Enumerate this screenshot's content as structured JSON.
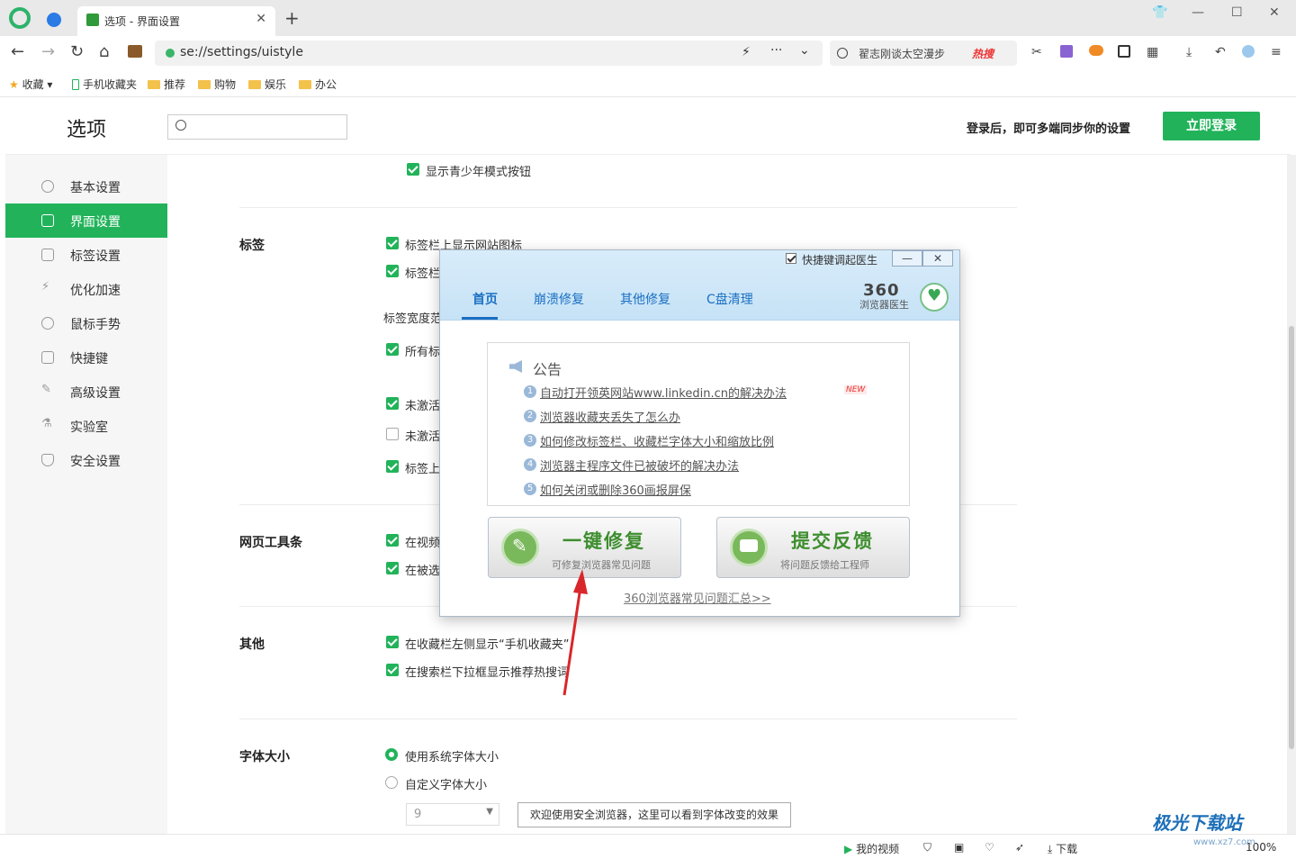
{
  "browser": {
    "tab_title": "选项 - 界面设置",
    "address": "se://settings/uistyle",
    "search_query": "翟志刚谈太空漫步",
    "search_hot": "热搜",
    "bookmarks": [
      "收藏",
      "手机收藏夹",
      "推荐",
      "购物",
      "娱乐",
      "办公"
    ]
  },
  "page": {
    "title": "选项",
    "login_hint": "登录后，即可多端同步你的设置",
    "login_button": "立即登录"
  },
  "sidebar": {
    "items": [
      {
        "label": "基本设置",
        "icon": "gear-icon"
      },
      {
        "label": "界面设置",
        "icon": "window-icon"
      },
      {
        "label": "标签设置",
        "icon": "tab-icon"
      },
      {
        "label": "优化加速",
        "icon": "lightning-icon"
      },
      {
        "label": "鼠标手势",
        "icon": "mouse-icon"
      },
      {
        "label": "快捷键",
        "icon": "keyboard-icon"
      },
      {
        "label": "高级设置",
        "icon": "wrench-icon"
      },
      {
        "label": "实验室",
        "icon": "flask-icon"
      },
      {
        "label": "安全设置",
        "icon": "shield-icon"
      }
    ]
  },
  "content": {
    "teen_mode": "显示青少年模式按钮",
    "tabs_section": "标签",
    "tabs_opt1": "标签栏上显示网站图标",
    "tabs_opt2": "标签栏",
    "tab_width": "标签宽度范",
    "tabs_opt3": "所有标",
    "tabs_opt4": "未激活",
    "tabs_opt5": "未激活",
    "tabs_opt6": "标签上",
    "toolbar_section": "网页工具条",
    "toolbar_opt1": "在视频",
    "toolbar_opt2": "在被选",
    "other_section": "其他",
    "other_opt1": "在收藏栏左侧显示“手机收藏夹”",
    "other_opt2": "在搜索栏下拉框显示推荐热搜词",
    "font_section": "字体大小",
    "font_opt1": "使用系统字体大小",
    "font_opt2": "自定义字体大小",
    "font_size_value": "9",
    "font_preview": "欢迎使用安全浏览器，这里可以看到字体改变的效果"
  },
  "statusbar": {
    "my_video": "我的视频",
    "download": "下载",
    "zoom": "100%"
  },
  "doctor": {
    "hotkey_label": "快捷键调起医生",
    "minimize": "—",
    "close": "✕",
    "tabs": [
      "首页",
      "崩溃修复",
      "其他修复",
      "C盘清理"
    ],
    "brand": "360",
    "brand_sub": "浏览器医生",
    "notice_title": "公告",
    "notice_items": [
      "自动打开领英网站www.linkedin.cn的解决办法",
      "浏览器收藏夹丢失了怎么办",
      "如何修改标签栏、收藏栏字体大小和缩放比例",
      "浏览器主程序文件已被破坏的解决办法",
      "如何关闭或删除360画报屏保"
    ],
    "new_badge": "NEW",
    "repair_title": "一键修复",
    "repair_sub": "可修复浏览器常见问题",
    "feedback_title": "提交反馈",
    "feedback_sub": "将问题反馈给工程师",
    "faq_link": "360浏览器常见问题汇总>>"
  },
  "watermark": {
    "title": "极光下载站",
    "sub": "www.xz7.com"
  },
  "colors": {
    "accent": "#22b35a",
    "dialog_link": "#1a6fc2",
    "arrow": "#d9262a"
  }
}
